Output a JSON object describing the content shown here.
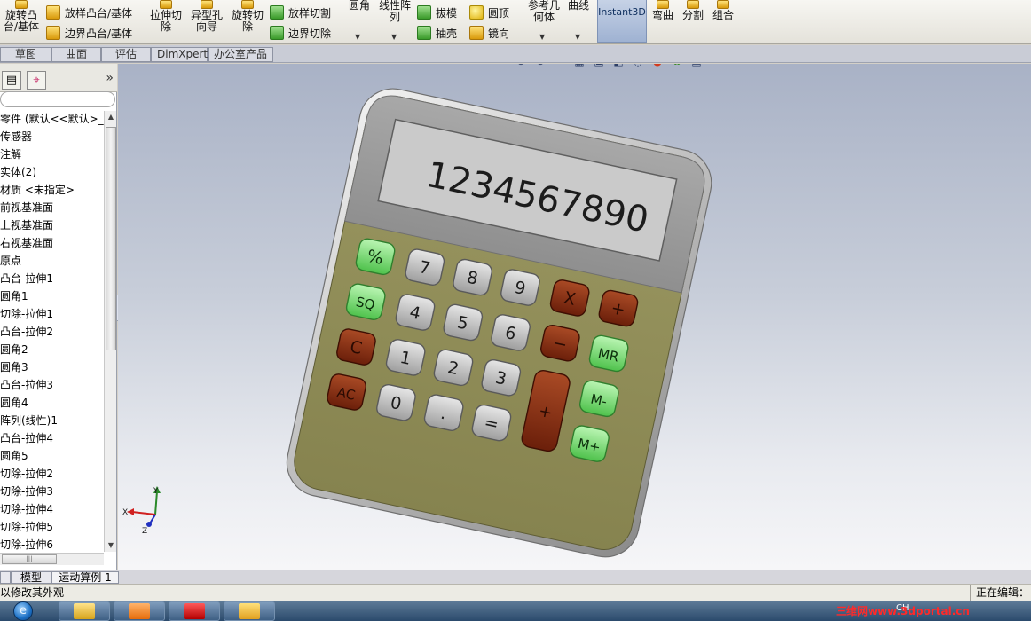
{
  "ribbon": {
    "revolve_boss": "旋转凸\n台/基体",
    "loft_boss": "放样凸台/基体",
    "boundary_boss": "边界凸台/基体",
    "extrude_cut": "拉伸切\n除",
    "hole_wizard": "异型孔\n向导",
    "revolve_cut": "旋转切\n除",
    "loft_cut": "放样切割",
    "boundary_cut": "边界切除",
    "fillet": "圆角",
    "linear_pattern": "线性阵\n列",
    "draft": "拔模",
    "shell": "抽壳",
    "dome": "圆顶",
    "mirror": "镜向",
    "ref_geometry": "参考几\n何体",
    "curves": "曲线",
    "instant3d": "Instant3D",
    "flex": "弯曲",
    "split": "分割",
    "combine": "组合"
  },
  "tabs": [
    "草图",
    "曲面",
    "评估",
    "DimXpert",
    "办公室产品"
  ],
  "feature_tree": {
    "items": [
      "零件 (默认<<默认>_显示",
      "传感器",
      "注解",
      "实体(2)",
      "材质 <未指定>",
      "前视基准面",
      "上视基准面",
      "右视基准面",
      "原点",
      "凸台-拉伸1",
      "圆角1",
      "切除-拉伸1",
      "凸台-拉伸2",
      "圆角2",
      "圆角3",
      "凸台-拉伸3",
      "圆角4",
      "阵列(线性)1",
      "凸台-拉伸4",
      "圆角5",
      "切除-拉伸2",
      "切除-拉伸3",
      "切除-拉伸4",
      "切除-拉伸5",
      "切除-拉伸6"
    ]
  },
  "calculator": {
    "display_number": "1234567890",
    "keys": {
      "percent": "%",
      "sq": "SQ",
      "c": "C",
      "ac": "AC",
      "k7": "7",
      "k8": "8",
      "k9": "9",
      "k4": "4",
      "k5": "5",
      "k6": "6",
      "k1": "1",
      "k2": "2",
      "k3": "3",
      "k0": "0",
      "dot": ".",
      "equals": "=",
      "mul": "X",
      "add_small": "+",
      "minus": "−",
      "plus_tall": "+",
      "mr": "MR",
      "m_minus": "M-",
      "m_plus": "M+"
    },
    "colors": {
      "body": "#8f8c58",
      "top_panel": "#9a9a9a",
      "screen": "#c9c9c9",
      "green_key": "#7be07a",
      "gray_key": "#b0b0b0",
      "brown_key": "#8a2a12"
    }
  },
  "triad": {
    "x": "X",
    "y": "Y",
    "z": "Z"
  },
  "bottom_tabs": [
    "模型",
    "运动算例 1"
  ],
  "status": {
    "left": "以修改其外观",
    "right": "正在编辑："
  },
  "taskbar": {
    "watermark": "三维网www.3dportal.cn",
    "tray": "CH"
  }
}
